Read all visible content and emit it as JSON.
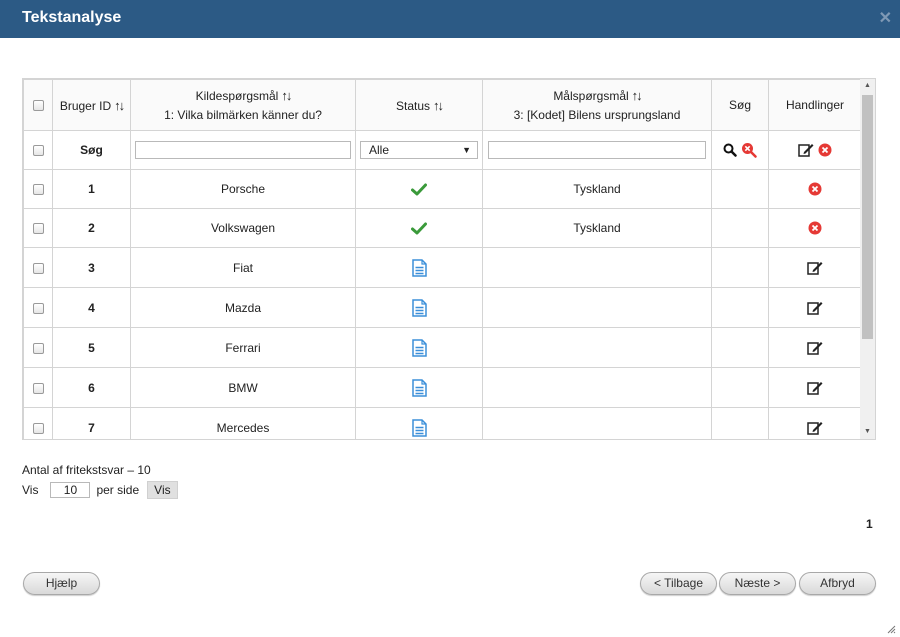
{
  "window": {
    "title": "Tekstanalyse"
  },
  "table": {
    "headers": {
      "user_id": "Bruger ID",
      "source": "Kildespørgsmål",
      "source_sub": "1: Vilka bilmärken känner du?",
      "status": "Status",
      "target": "Målspørgsmål",
      "target_sub": "3: [Kodet] Bilens ursprungsland",
      "search": "Søg",
      "actions": "Handlinger"
    },
    "filter": {
      "label": "Søg",
      "status_selected": "Alle"
    },
    "rows": [
      {
        "id": "1",
        "source": "Porsche",
        "status": "coded",
        "target": "Tyskland"
      },
      {
        "id": "2",
        "source": "Volkswagen",
        "status": "coded",
        "target": "Tyskland"
      },
      {
        "id": "3",
        "source": "Fiat",
        "status": "document",
        "target": ""
      },
      {
        "id": "4",
        "source": "Mazda",
        "status": "document",
        "target": ""
      },
      {
        "id": "5",
        "source": "Ferrari",
        "status": "document",
        "target": ""
      },
      {
        "id": "6",
        "source": "BMW",
        "status": "document",
        "target": ""
      },
      {
        "id": "7",
        "source": "Mercedes",
        "status": "document",
        "target": ""
      }
    ]
  },
  "footer": {
    "count_text": "Antal af fritekstsvar – 10",
    "show_label": "Vis",
    "per_page_value": "10",
    "per_page_label": "per side",
    "show_button": "Vis",
    "page_number": "1"
  },
  "buttons": {
    "help": "Hjælp",
    "back": "< Tilbage",
    "next": "Næste >",
    "cancel": "Afbryd"
  },
  "colors": {
    "titlebar": "#2c5a85",
    "check": "#3a9a3a",
    "doc": "#3b8fd9",
    "delete": "#e53935"
  },
  "icons": {
    "coded": "check-icon",
    "document": "document-icon",
    "delete": "delete-icon",
    "edit": "edit-icon",
    "search": "search-icon",
    "clear": "clear-search-icon"
  }
}
